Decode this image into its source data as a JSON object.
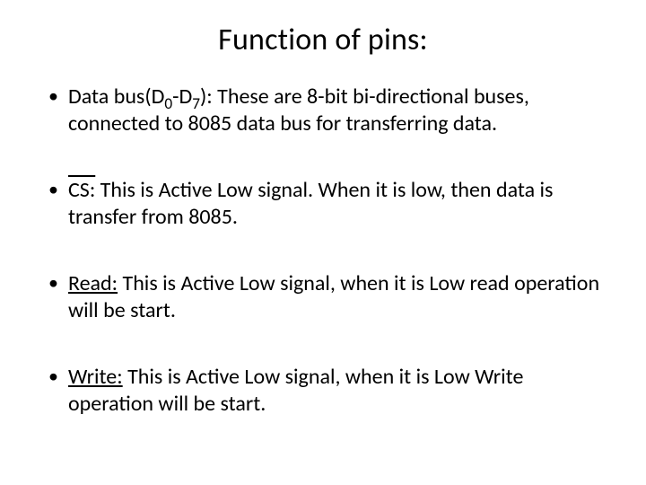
{
  "slide": {
    "title": "Function of pins:",
    "bullets": [
      {
        "lead": "Data bus(D",
        "sub0": "0",
        "mid": "-D",
        "sub7": "7",
        "rest": "): These are 8-bit bi-directional buses, connected to 8085 data bus for transferring data."
      },
      {
        "label": "CS:",
        "rest": " This is Active Low signal. When it is low, then data is transfer from 8085."
      },
      {
        "label": "Read:",
        "rest": " This is Active Low signal, when it is Low read operation will be start."
      },
      {
        "label": "Write:",
        "rest": " This is Active Low signal, when it is Low Write operation will be start."
      }
    ]
  }
}
